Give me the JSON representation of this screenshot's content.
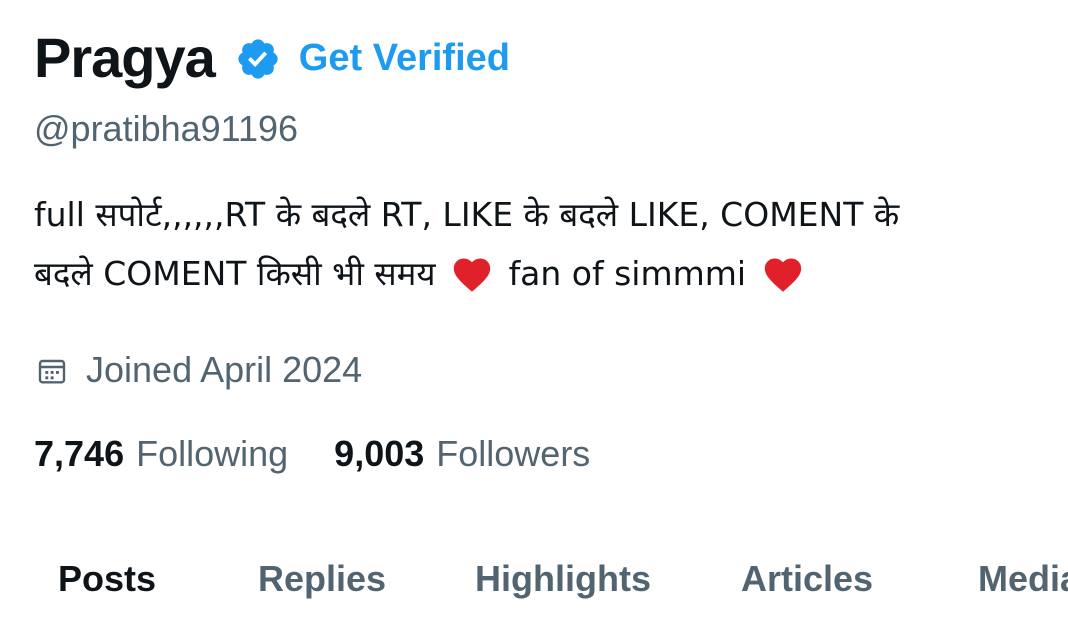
{
  "profile": {
    "name": "Pragya",
    "get_verified_label": "Get Verified",
    "handle": "@pratibha91196",
    "bio": {
      "line1": "full सपोर्ट,,,,,,RT के बदले RT, LIKE के बदले LIKE, COMENT के",
      "line2_a": "बदले COMENT किसी भी समय",
      "line2_b": "fan of simmmi"
    },
    "joined": "Joined April 2024",
    "following_count": "7,746",
    "following_label": "Following",
    "followers_count": "9,003",
    "followers_label": "Followers"
  },
  "tabs": [
    {
      "label": "Posts",
      "active": true
    },
    {
      "label": "Replies",
      "active": false
    },
    {
      "label": "Highlights",
      "active": false
    },
    {
      "label": "Articles",
      "active": false
    },
    {
      "label": "Media",
      "active": false
    }
  ],
  "icons": {
    "verified": "verified-badge-icon",
    "heart": "heart-icon",
    "calendar": "calendar-icon"
  },
  "colors": {
    "primary_text": "#0f1419",
    "secondary_text": "#536471",
    "accent": "#1d9bf0",
    "heart": "#e0202a"
  }
}
